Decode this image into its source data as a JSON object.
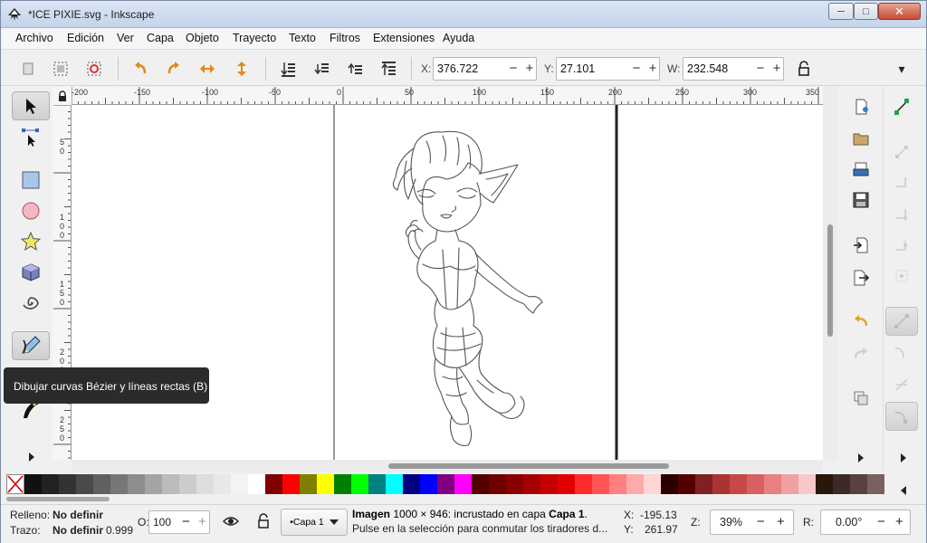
{
  "window": {
    "title": "*ICE PIXIE.svg - Inkscape",
    "minimize_glyph": "─",
    "maximize_glyph": "□",
    "close_glyph": "✕"
  },
  "menu": [
    "Archivo",
    "Edición",
    "Ver",
    "Capa",
    "Objeto",
    "Trayecto",
    "Texto",
    "Filtros",
    "Extensiones",
    "Ayuda"
  ],
  "toolbar": {
    "x_label": "X:",
    "x_value": "376.722",
    "y_label": "Y:",
    "y_value": "27.101",
    "w_label": "W:",
    "w_value": "232.548",
    "minus": "−",
    "plus": "+",
    "overflow_arrow": "▾"
  },
  "ruler_top_labels": [
    "-200",
    "-150",
    "-100",
    "-50",
    "0",
    "50",
    "100",
    "150",
    "200",
    "250",
    "300",
    "350"
  ],
  "ruler_left_labels": [
    "5",
    "0",
    "1",
    "0",
    "0",
    "1",
    "5",
    "0",
    "2",
    "0",
    "0",
    "2",
    "5",
    "0"
  ],
  "tooltip": "Dibujar curvas Bézier y líneas rectas (B)",
  "palette_colors": [
    "#111111",
    "#222222",
    "#333333",
    "#4a4a4a",
    "#606060",
    "#777777",
    "#8d8d8d",
    "#a4a4a4",
    "#bbbbbb",
    "#cccccc",
    "#dddddd",
    "#e8e8e8",
    "#f3f3f3",
    "#ffffff",
    "#800000",
    "#ff0000",
    "#808000",
    "#ffff00",
    "#008000",
    "#00ff00",
    "#008080",
    "#00ffff",
    "#000080",
    "#0000ff",
    "#800080",
    "#ff00ff",
    "#550000",
    "#6e0000",
    "#8a0000",
    "#a60000",
    "#c40000",
    "#e00000",
    "#ff2a2a",
    "#ff5555",
    "#ff8080",
    "#ffaaaa",
    "#ffd5d5",
    "#2b0000",
    "#550000",
    "#802020",
    "#aa3333",
    "#c84848",
    "#d86060",
    "#e88080",
    "#f0a0a0",
    "#f8c8c8",
    "#28170b",
    "#3c2a2a",
    "#5a4040",
    "#7a6060"
  ],
  "status": {
    "fill_label": "Relleno:",
    "fill_value": "No definir",
    "stroke_label": "Trazo:",
    "stroke_value": "No definir",
    "stroke_width": "0.999",
    "opacity_label": "O:",
    "opacity_value": "100",
    "layer": "•Capa 1",
    "msg_bold": "Imagen",
    "msg_rest": " 1000 × 946: incrustado en capa ",
    "msg_layer": "Capa 1",
    "msg_end": ".",
    "msg_line2": "Pulse en la selección para conmutar los tiradores d...",
    "cx_label": "X:",
    "cx_value": "-195.13",
    "cy_label": "Y:",
    "cy_value": "261.97",
    "zoom_label": "Z:",
    "zoom_value": "39%",
    "rot_label": "R:",
    "rot_value": "0.00°"
  }
}
